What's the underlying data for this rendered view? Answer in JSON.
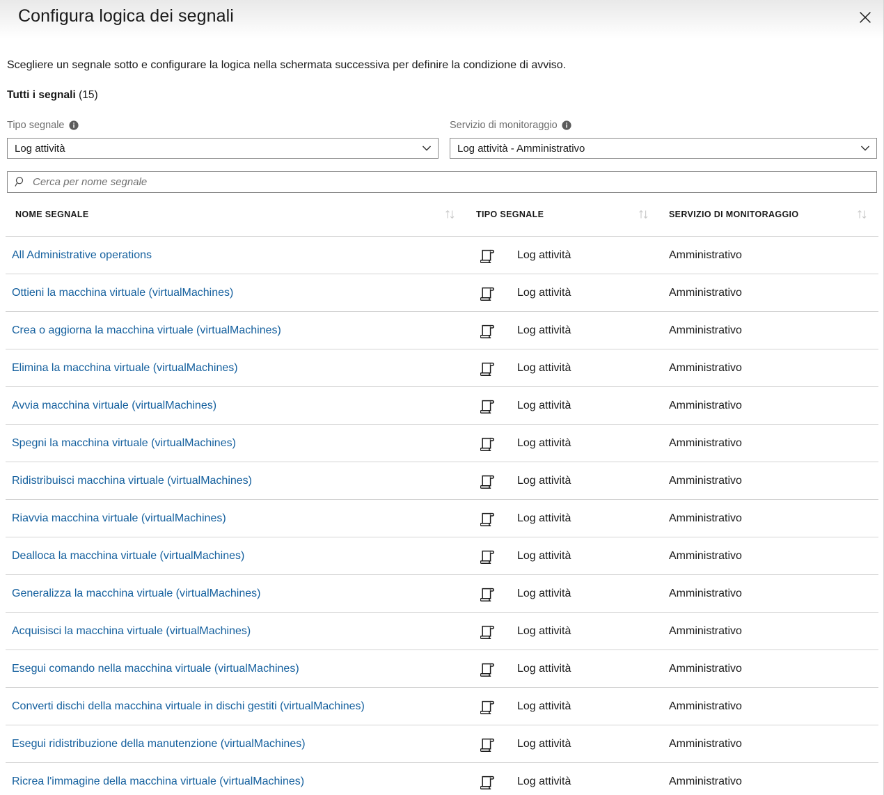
{
  "panel": {
    "title": "Configura logica dei segnali",
    "close_icon": "close-icon",
    "description": "Scegliere un segnale sotto e configurare la logica nella schermata successiva per definire la condizione di avviso.",
    "all_signals_label": "Tutti i segnali",
    "all_signals_count": "(15)"
  },
  "filters": {
    "signal_type": {
      "label": "Tipo segnale",
      "info_icon": "info-icon",
      "value": "Log attività",
      "chevron_icon": "chevron-down-icon"
    },
    "monitor_service": {
      "label": "Servizio di monitoraggio",
      "info_icon": "info-icon",
      "value": "Log attività - Amministrativo",
      "chevron_icon": "chevron-down-icon"
    }
  },
  "search": {
    "icon": "search-icon",
    "placeholder": "Cerca per nome segnale",
    "value": ""
  },
  "table": {
    "columns": [
      {
        "label": "NOME SEGNALE",
        "sort_icon": "sort-arrows-icon"
      },
      {
        "label": "TIPO SEGNALE",
        "sort_icon": "sort-arrows-icon"
      },
      {
        "label": "SERVIZIO DI MONITORAGGIO",
        "sort_icon": "sort-arrows-icon"
      }
    ],
    "row_icon": "activity-log-scroll-icon",
    "rows": [
      {
        "name": "All Administrative operations",
        "type": "Log attività",
        "service": "Amministrativo"
      },
      {
        "name": "Ottieni la macchina virtuale (virtualMachines)",
        "type": "Log attività",
        "service": "Amministrativo"
      },
      {
        "name": "Crea o aggiorna la macchina virtuale (virtualMachines)",
        "type": "Log attività",
        "service": "Amministrativo"
      },
      {
        "name": "Elimina la macchina virtuale (virtualMachines)",
        "type": "Log attività",
        "service": "Amministrativo"
      },
      {
        "name": "Avvia macchina virtuale (virtualMachines)",
        "type": "Log attività",
        "service": "Amministrativo"
      },
      {
        "name": "Spegni la macchina virtuale (virtualMachines)",
        "type": "Log attività",
        "service": "Amministrativo"
      },
      {
        "name": "Ridistribuisci macchina virtuale (virtualMachines)",
        "type": "Log attività",
        "service": "Amministrativo"
      },
      {
        "name": "Riavvia macchina virtuale (virtualMachines)",
        "type": "Log attività",
        "service": "Amministrativo"
      },
      {
        "name": "Dealloca la macchina virtuale (virtualMachines)",
        "type": "Log attività",
        "service": "Amministrativo"
      },
      {
        "name": "Generalizza la macchina virtuale (virtualMachines)",
        "type": "Log attività",
        "service": "Amministrativo"
      },
      {
        "name": "Acquisisci la macchina virtuale (virtualMachines)",
        "type": "Log attività",
        "service": "Amministrativo"
      },
      {
        "name": "Esegui comando nella macchina virtuale (virtualMachines)",
        "type": "Log attività",
        "service": "Amministrativo"
      },
      {
        "name": "Converti dischi della macchina virtuale in dischi gestiti (virtualMachines)",
        "type": "Log attività",
        "service": "Amministrativo"
      },
      {
        "name": "Esegui ridistribuzione della manutenzione (virtualMachines)",
        "type": "Log attività",
        "service": "Amministrativo"
      },
      {
        "name": "Ricrea l'immagine della macchina virtuale (virtualMachines)",
        "type": "Log attività",
        "service": "Amministrativo"
      }
    ]
  },
  "colors": {
    "link": "#15609e",
    "text": "#1a1a1a",
    "muted": "#6e6e6e",
    "border": "#8a8a8a",
    "divider": "#d3d3d3"
  }
}
